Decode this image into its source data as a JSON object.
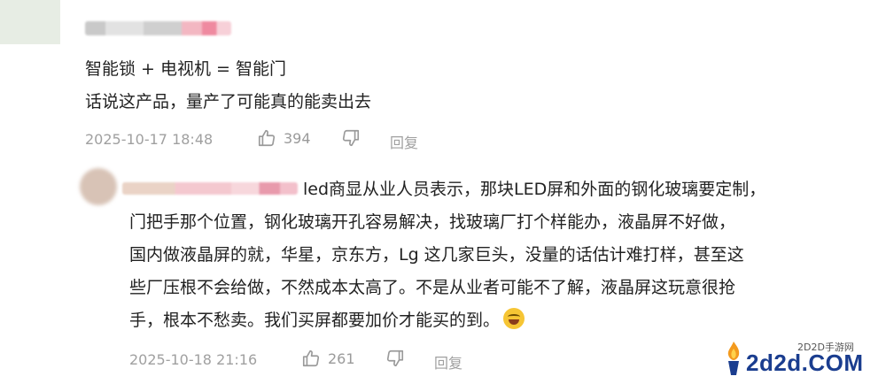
{
  "comments": [
    {
      "lines": [
        "智能锁 + 电视机 = 智能门",
        "话说这产品，量产了可能真的能卖出去"
      ],
      "date": "2025-10-17 18:48",
      "likes": "394",
      "reply_label": "回复"
    },
    {
      "lines": [
        "led商显从业人员表示，那块LED屏和外面的钢化玻璃要定制，",
        "门把手那个位置，钢化玻璃开孔容易解决，找玻璃厂打个样能办，液晶屏不好做，",
        "国内做液晶屏的就，华星，京东方，Lg 这几家巨头，没量的话估计难打样，甚至这",
        "些厂压根不会给做，不然成本太高了。不是从业者可能不了解，液晶屏这玩意很抢",
        "手，根本不愁卖。我们买屏都要加价才能买的到。"
      ],
      "date": "2025-10-18 21:16",
      "likes": "261",
      "reply_label": "回复"
    }
  ],
  "watermark": {
    "small": "2D2D手游网",
    "big": "2d2d.COM"
  },
  "icons": [
    "thumbs-up-icon",
    "thumbs-down-icon",
    "crying-laugh-emoji"
  ]
}
